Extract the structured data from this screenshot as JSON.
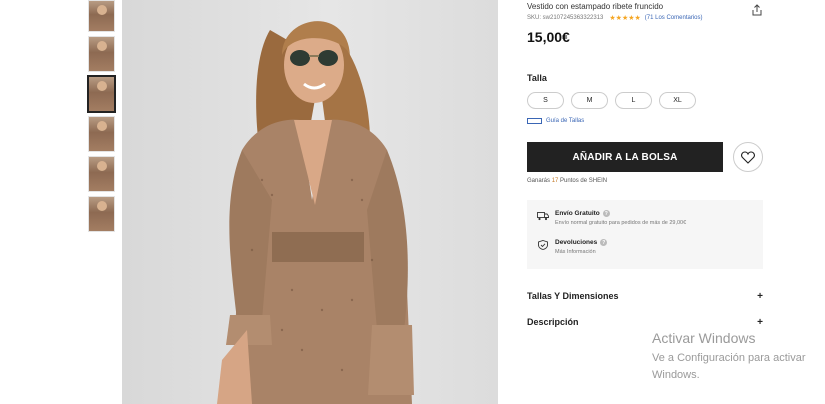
{
  "product": {
    "name": "Vestido con estampado ribete fruncido",
    "sku": "SKU: sw2107245363322313",
    "stars": "★★★★★",
    "reviews": "(71 Los Comentarios)",
    "price": "15,00€"
  },
  "sizes": {
    "label": "Talla",
    "options": [
      "S",
      "M",
      "L",
      "XL"
    ],
    "guide_label": "Guía de Tallas"
  },
  "actions": {
    "add_to_bag": "AÑADIR A LA BOLSA",
    "points_prefix": "Ganarás ",
    "points_value": "17",
    "points_suffix": " Puntos de SHEIN"
  },
  "shipping": {
    "free_title": "Envío Gratuito",
    "free_desc": "Envío normal gratuito para pedidos de más de 29,00€",
    "returns_title": "Devoluciones",
    "returns_desc": "Más Información"
  },
  "accordion": [
    {
      "label": "Tallas Y Dimensiones",
      "icon": "+"
    },
    {
      "label": "Descripción",
      "icon": "+"
    }
  ],
  "gallery": {
    "thumbnail_count": 6,
    "active_index": 2
  },
  "watermark": {
    "title": "Activar Windows",
    "line1": "Ve a Configuración para activar",
    "line2": "Windows."
  },
  "colors": {
    "accent_button": "#222222",
    "stars": "#f5a623",
    "link": "#3a66b5",
    "points": "#c47b2a"
  }
}
